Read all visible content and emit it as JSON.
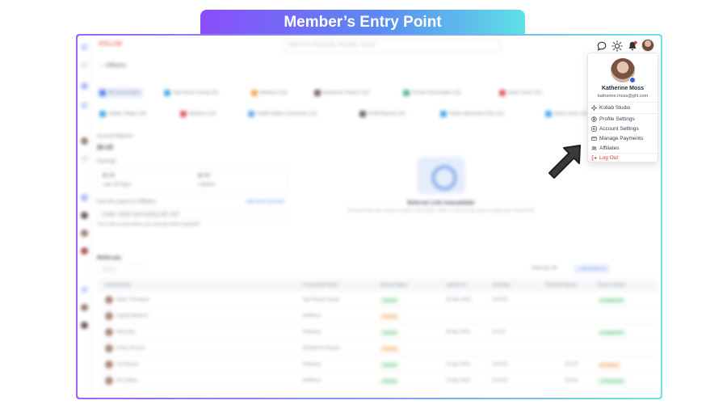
{
  "banner": {
    "title": "Member’s Entry Point"
  },
  "app": {
    "logo_text": "KOLLAB",
    "search_placeholder": "Search for community, message, tutorial",
    "breadcrumb": "Affiliates"
  },
  "communities": [
    {
      "label": "All Communities",
      "color": "#4c7cf0",
      "active": true
    },
    {
      "label": "Tap Fitness Group (13)",
      "color": "#3aa3e8"
    },
    {
      "label": "Wellness (13)",
      "color": "#f0a04b"
    },
    {
      "label": "Bookworm Players (13)",
      "color": "#6b5a52"
    },
    {
      "label": "Private Chat Region (13)",
      "color": "#4bb38a"
    },
    {
      "label": "Home Circle (13)",
      "color": "#d9534f"
    },
    {
      "label": "Holistic Village (13)",
      "color": "#3aa3e8"
    },
    {
      "label": "Wellness (13)",
      "color": "#d9534f"
    },
    {
      "label": "Health Nation Community (13)",
      "color": "#5fa8e8"
    },
    {
      "label": "Of All Reports (13)",
      "color": "#5b5b5b"
    },
    {
      "label": "Smiles Movement Club (13)",
      "color": "#3aa3e8"
    },
    {
      "label": "Active Circle (13)",
      "color": "#3aa3e8"
    }
  ],
  "left_panel": {
    "balance_label": "Account Balance",
    "balance_value": "$0.00",
    "earnings_label": "Earnings",
    "earn_value": "$0.00",
    "earn_caption": "Last 30 Days",
    "lifetime_value": "$0.00",
    "lifetime_caption": "Lifetime",
    "payout_label": "Earn the payout to Affiliates",
    "payout_link": "Add bank account",
    "payout_select": "Credit / Debit Card ending with 1167",
    "payout_note": "This is the account where your earnings will be deposited"
  },
  "empty_state": {
    "title": "Referral Link Unavailable",
    "text": "Referral links are unique to each community. Select a community above to get your referral link"
  },
  "referrals": {
    "heading": "Referrals",
    "search_placeholder": "Search",
    "filter_label": "Referrals: All",
    "add_label": "+ Add Referral",
    "columns": [
      "Invited Name",
      "Community Name",
      "Joining Status",
      "Joined On",
      "Earnings",
      "Pending Payout",
      "Payout Status"
    ],
    "rows": [
      {
        "name": "Elijah Thompson",
        "community": "Tap Fitness Group",
        "status": "Joined",
        "status_type": "green",
        "date": "03 Mar 2024",
        "earn": "$ 20.00",
        "pending": "",
        "payout": "Completed",
        "payout_type": "green"
      },
      {
        "name": "Angela Martinez",
        "community": "Wellness",
        "status": "Invited",
        "status_type": "orange",
        "date": "",
        "earn": "",
        "pending": "",
        "payout": "",
        "payout_type": ""
      },
      {
        "name": "Rita Kelly",
        "community": "Wellness",
        "status": "Joined",
        "status_type": "green",
        "date": "04 Apr 2024",
        "earn": "$ 0.00",
        "pending": "",
        "payout": "Completed",
        "payout_type": "green"
      },
      {
        "name": "Emily Johnson",
        "community": "Bookworm Players",
        "status": "Invited",
        "status_type": "orange",
        "date": "",
        "earn": "",
        "pending": "",
        "payout": "",
        "payout_type": ""
      },
      {
        "name": "Carl Brown",
        "community": "Wellness",
        "status": "Joined",
        "status_type": "green",
        "date": "12 Apr 2024",
        "earn": "$ 20.00",
        "pending": "$ 0.00",
        "payout": "Pending",
        "payout_type": "orange"
      },
      {
        "name": "Ana Mateo",
        "community": "Wellness",
        "status": "Joined",
        "status_type": "green",
        "date": "13 Apr 2024",
        "earn": "$ 20.00",
        "pending": "$ 0.00",
        "payout": "Completed",
        "payout_type": "green"
      }
    ]
  },
  "header_icons": [
    "chat-icon",
    "sun-icon",
    "bell-icon"
  ],
  "profile_menu": {
    "name": "Katherine Moss",
    "email": "katherine.moss@ghl.com",
    "items": [
      {
        "label": "Kollab Studio",
        "icon": "sparkle-icon"
      },
      {
        "label": "Profile Settings",
        "icon": "user-circle-icon"
      },
      {
        "label": "Account Settings",
        "icon": "settings-icon"
      },
      {
        "label": "Manage Payments",
        "icon": "card-icon"
      },
      {
        "label": "Affiliates",
        "icon": "users-icon"
      },
      {
        "label": "Log Out",
        "icon": "logout-icon"
      }
    ]
  },
  "colors": {
    "accent_purple": "#8a4dfa",
    "accent_cyan": "#5fe0e6",
    "logout_red": "#d9342b"
  }
}
